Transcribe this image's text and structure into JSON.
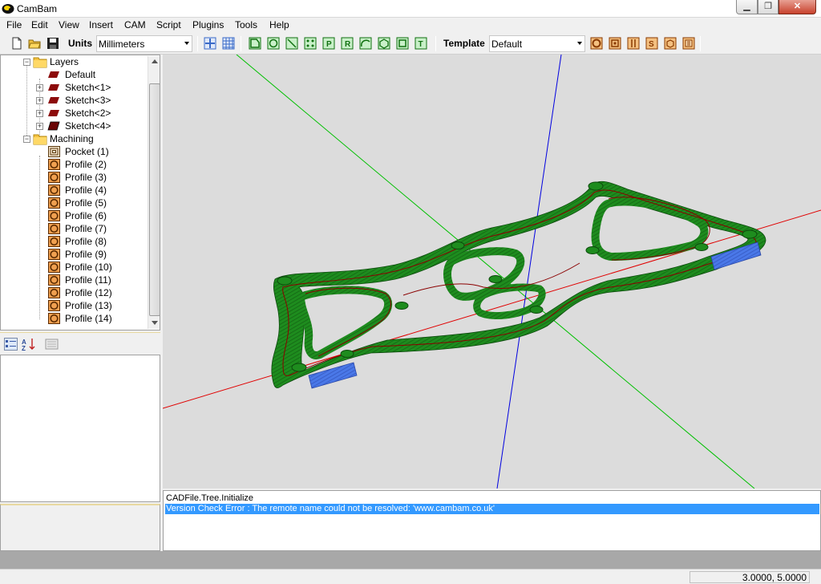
{
  "window": {
    "title": "CamBam",
    "minimize_glyph": "▁",
    "maximize_glyph": "❐",
    "close_glyph": "✕"
  },
  "menu": {
    "items": [
      "File",
      "Edit",
      "View",
      "Insert",
      "CAM",
      "Script",
      "Plugins",
      "Tools",
      "Help"
    ]
  },
  "toolbar": {
    "units_label": "Units",
    "units_value": "Millimeters",
    "template_label": "Template",
    "template_value": "Default",
    "icons": [
      "new-file-icon",
      "open-folder-icon",
      "save-icon",
      "snap-icon",
      "grid-icon",
      "polyline-icon",
      "circle-icon",
      "line-icon",
      "points-icon",
      "p-poly-icon",
      "r-rect-icon",
      "arc-icon",
      "polygon-icon",
      "rectangle-icon",
      "text-icon",
      "profile-op-icon",
      "pocket-op-icon",
      "drill-op-icon",
      "engrave-op-icon",
      "3d-op-icon",
      "lathe-op-icon"
    ]
  },
  "tree": {
    "layers_label": "Layers",
    "layers": [
      "Default",
      "Sketch<1>",
      "Sketch<3>",
      "Sketch<2>",
      "Sketch<4>"
    ],
    "machining_label": "Machining",
    "operations": [
      "Pocket (1)",
      "Profile (2)",
      "Profile (3)",
      "Profile (4)",
      "Profile (5)",
      "Profile (6)",
      "Profile (7)",
      "Profile (8)",
      "Profile (9)",
      "Profile (10)",
      "Profile (11)",
      "Profile (12)",
      "Profile (13)",
      "Profile (14)"
    ]
  },
  "log": {
    "lines": [
      "CADFile.Tree.Initialize",
      "Version Check Error : The remote name could not be resolved: 'www.cambam.co.uk'"
    ],
    "selected_index": 1
  },
  "status": {
    "coords": "3.0000, 5.0000"
  },
  "colors": {
    "toolpath_green": "#1e8c1e",
    "axis_x": "#e00000",
    "axis_y": "#00c000",
    "axis_z": "#0000e0",
    "selection_blue": "#3399ff",
    "highlight_blue": "#4a78e8"
  }
}
